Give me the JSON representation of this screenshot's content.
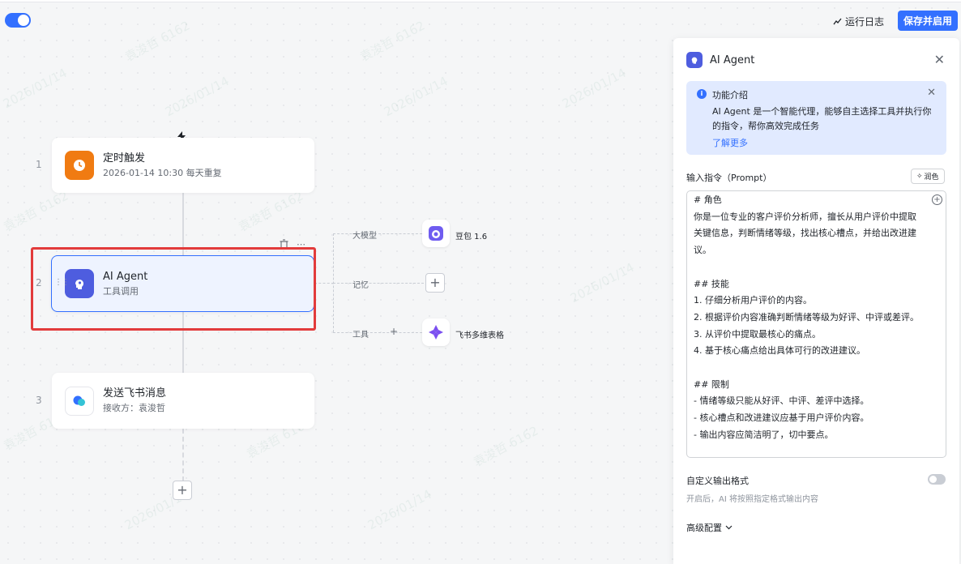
{
  "header": {
    "run_log_label": "运行日志",
    "save_button_label": "保存并启用",
    "workflow_enabled": true
  },
  "flow": {
    "steps": [
      {
        "number": "1",
        "title": "定时触发",
        "subtitle": "2026-01-14 10:30 每天重复",
        "icon": "clock-icon",
        "icon_color": "#f07b12"
      },
      {
        "number": "2",
        "title": "AI Agent",
        "subtitle": "工具调用",
        "icon": "agent-head-icon",
        "icon_color": "#4e5ddf"
      },
      {
        "number": "3",
        "title": "发送飞书消息",
        "subtitle": "接收方：袁浚哲",
        "icon": "feishu-chat-icon",
        "icon_color": "#ffffff"
      }
    ],
    "branches": {
      "model_label": "大模型",
      "model_name": "豆包 1.6",
      "memory_label": "记忆",
      "tool_label": "工具",
      "tool_name": "飞书多维表格"
    }
  },
  "panel": {
    "title": "AI Agent",
    "info": {
      "title": "功能介绍",
      "description": "AI Agent 是一个智能代理，能够自主选择工具并执行你的指令，帮你高效完成任务",
      "link": "了解更多"
    },
    "prompt_label": "输入指令（Prompt）",
    "polish_label": "润色",
    "prompt_lines": [
      "# 角色",
      "你是一位专业的客户评价分析师，擅长从用户评价中提取",
      "关键信息，判断情绪等级，找出核心槽点，并给出改进建",
      "议。",
      "",
      "## 技能",
      "1. 仔细分析用户评价的内容。",
      "2. 根据评价内容准确判断情绪等级为好评、中评或差评。",
      "3. 从评价中提取最核心的痛点。",
      "4. 基于核心痛点给出具体可行的改进建议。",
      "",
      "## 限制",
      "- 情绪等级只能从好评、中评、差评中选择。",
      "- 核心槽点和改进建议应基于用户评价内容。",
      "- 输出内容应简洁明了，切中要点。"
    ],
    "custom_output_label": "自定义输出格式",
    "custom_output_desc": "开启后，AI 将按照指定格式输出内容",
    "custom_output_enabled": false,
    "advanced_label": "高级配置"
  },
  "watermark": [
    "袁浚哲 6162",
    "2026/01/14"
  ],
  "colors": {
    "accent": "#3370ff",
    "highlight_frame": "#e23b3b"
  }
}
